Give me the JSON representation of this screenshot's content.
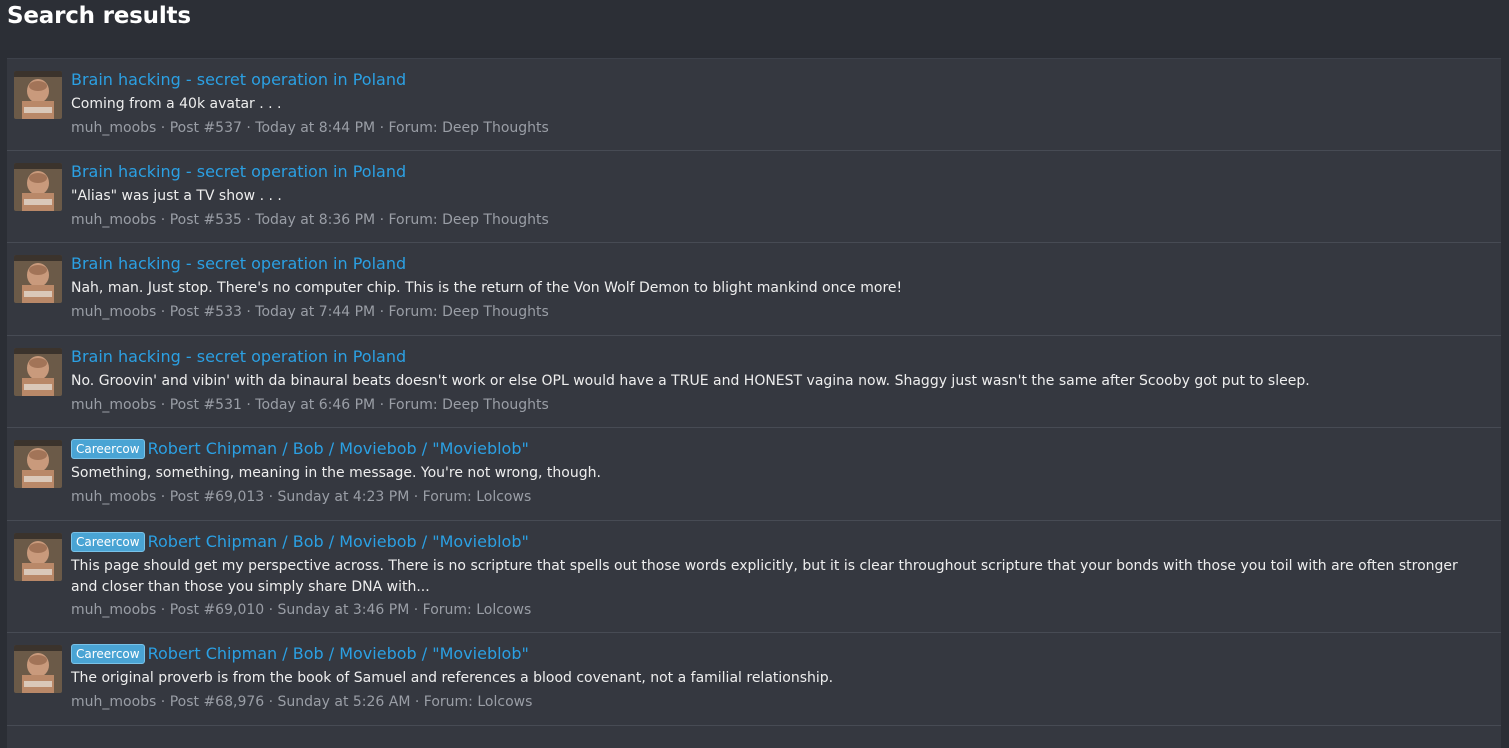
{
  "page": {
    "title": "Search results"
  },
  "results": [
    {
      "prefix": "",
      "title": "Brain hacking - secret operation in Poland",
      "snippet": "Coming from a 40k avatar . . .",
      "author": "muh_moobs",
      "post": "Post #537",
      "date": "Today at 8:44 PM",
      "forum_label": "Forum:",
      "forum": "Deep Thoughts"
    },
    {
      "prefix": "",
      "title": "Brain hacking - secret operation in Poland",
      "snippet": "\"Alias\" was just a TV show . . .",
      "author": "muh_moobs",
      "post": "Post #535",
      "date": "Today at 8:36 PM",
      "forum_label": "Forum:",
      "forum": "Deep Thoughts"
    },
    {
      "prefix": "",
      "title": "Brain hacking - secret operation in Poland",
      "snippet": "Nah, man. Just stop. There's no computer chip. This is the return of the Von Wolf Demon to blight mankind once more!",
      "author": "muh_moobs",
      "post": "Post #533",
      "date": "Today at 7:44 PM",
      "forum_label": "Forum:",
      "forum": "Deep Thoughts"
    },
    {
      "prefix": "",
      "title": "Brain hacking - secret operation in Poland",
      "snippet": "No. Groovin' and vibin' with da binaural beats doesn't work or else OPL would have a TRUE and HONEST vagina now. Shaggy just wasn't the same after Scooby got put to sleep.",
      "author": "muh_moobs",
      "post": "Post #531",
      "date": "Today at 6:46 PM",
      "forum_label": "Forum:",
      "forum": "Deep Thoughts"
    },
    {
      "prefix": "Careercow",
      "title": "Robert Chipman / Bob / Moviebob / \"Movieblob\"",
      "snippet": "Something, something, meaning in the message. You're not wrong, though.",
      "author": "muh_moobs",
      "post": "Post #69,013",
      "date": "Sunday at 4:23 PM",
      "forum_label": "Forum:",
      "forum": "Lolcows"
    },
    {
      "prefix": "Careercow",
      "title": "Robert Chipman / Bob / Moviebob / \"Movieblob\"",
      "snippet": "This page should get my perspective across. There is no scripture that spells out those words explicitly, but it is clear throughout scripture that your bonds with those you toil with are often stronger and closer than those you simply share DNA with...",
      "author": "muh_moobs",
      "post": "Post #69,010",
      "date": "Sunday at 3:46 PM",
      "forum_label": "Forum:",
      "forum": "Lolcows"
    },
    {
      "prefix": "Careercow",
      "title": "Robert Chipman / Bob / Moviebob / \"Movieblob\"",
      "snippet": "The original proverb is from the book of Samuel and references a blood covenant, not a familial relationship.",
      "author": "muh_moobs",
      "post": "Post #68,976",
      "date": "Sunday at 5:26 AM",
      "forum_label": "Forum:",
      "forum": "Lolcows"
    }
  ],
  "colors": {
    "background": "#2b2e35",
    "panel": "#353840",
    "link": "#2ba0e3",
    "prefix_badge": "#4aa4d4",
    "meta_text": "#9a9ea6"
  }
}
